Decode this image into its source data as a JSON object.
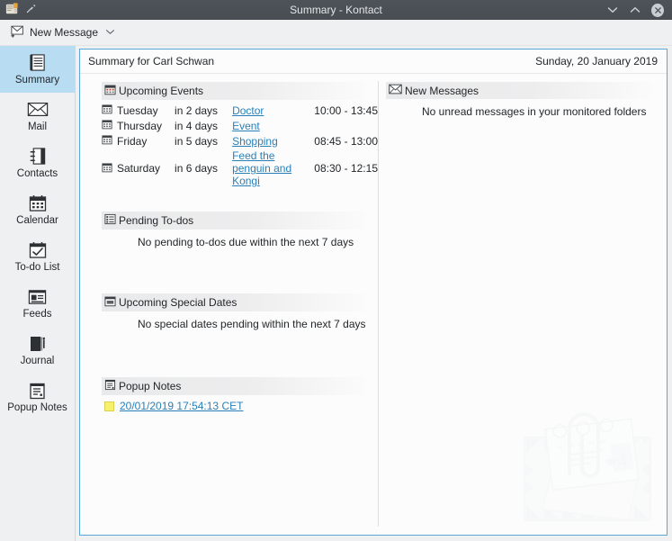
{
  "window": {
    "title": "Summary - Kontact",
    "app_icon": "kontact-icon",
    "pin_icon": "keep-above-icon",
    "controls": [
      {
        "name": "minimize-button",
        "icon": "chevron-down-icon"
      },
      {
        "name": "maximize-button",
        "icon": "chevron-up-icon"
      },
      {
        "name": "close-button",
        "icon": "close-icon"
      }
    ]
  },
  "toolbar": {
    "new_message_label": "New Message",
    "new_message_icon": "new-message-icon",
    "dropdown_icon": "chevron-down-icon"
  },
  "sidebar": {
    "items": [
      {
        "label": "Summary",
        "icon": "summary-icon",
        "active": true
      },
      {
        "label": "Mail",
        "icon": "mail-icon",
        "active": false
      },
      {
        "label": "Contacts",
        "icon": "contacts-icon",
        "active": false
      },
      {
        "label": "Calendar",
        "icon": "calendar-icon",
        "active": false
      },
      {
        "label": "To-do List",
        "icon": "todo-list-icon",
        "active": false
      },
      {
        "label": "Feeds",
        "icon": "feeds-icon",
        "active": false
      },
      {
        "label": "Journal",
        "icon": "journal-icon",
        "active": false
      },
      {
        "label": "Popup Notes",
        "icon": "popup-notes-icon",
        "active": false
      }
    ]
  },
  "summary": {
    "title": "Summary for Carl Schwan",
    "date": "Sunday, 20 January 2019",
    "upcoming_events": {
      "header": "Upcoming Events",
      "icon": "calendar-icon",
      "events": [
        {
          "day": "Tuesday",
          "relative": "in 2 days",
          "name": "Doctor",
          "time": "10:00 - 13:45",
          "icon": "calendar-icon"
        },
        {
          "day": "Thursday",
          "relative": "in 4 days",
          "name": "Event",
          "time": "",
          "icon": "calendar-icon"
        },
        {
          "day": "Friday",
          "relative": "in 5 days",
          "name": "Shopping",
          "time": "08:45 - 13:00",
          "icon": "calendar-icon"
        },
        {
          "day": "Saturday",
          "relative": "in 6 days",
          "name": "Feed the penguin and Kongi",
          "time": "08:30 - 12:15",
          "icon": "calendar-icon"
        }
      ]
    },
    "pending_todos": {
      "header": "Pending To-dos",
      "icon": "todo-list-icon",
      "empty_message": "No pending to-dos due within the next 7 days"
    },
    "special_dates": {
      "header": "Upcoming Special Dates",
      "icon": "special-date-icon",
      "empty_message": "No special dates pending within the next 7 days"
    },
    "popup_notes": {
      "header": "Popup Notes",
      "icon": "popup-notes-icon",
      "notes": [
        {
          "label": "20/01/2019 17:54:13 CET",
          "icon": "sticky-note-icon"
        }
      ]
    },
    "new_messages": {
      "header": "New Messages",
      "icon": "mail-icon",
      "empty_message": "No unread messages in your monitored folders"
    }
  },
  "colors": {
    "titlebar": "#4a5055",
    "selection": "#b8dcf2",
    "link": "#2980b9",
    "focus_border": "#5ba7d8",
    "background": "#eff0f1",
    "note_yellow": "#f7f06a"
  }
}
